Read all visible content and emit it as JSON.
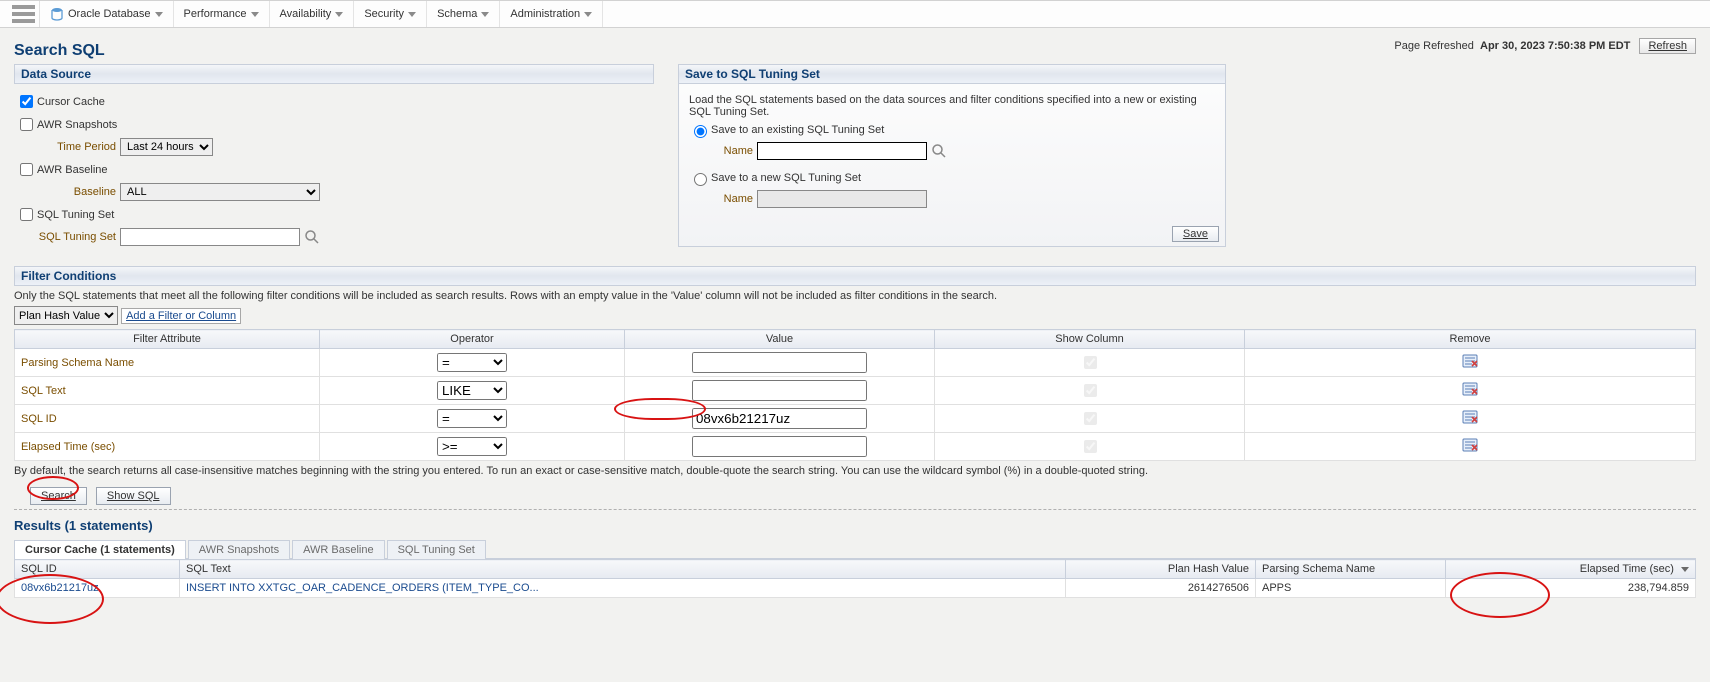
{
  "menu": {
    "items": [
      "Oracle Database",
      "Performance",
      "Availability",
      "Security",
      "Schema",
      "Administration"
    ]
  },
  "page_title": "Search SQL",
  "refresh": {
    "label": "Page Refreshed",
    "stamp": "Apr 30, 2023 7:50:38 PM EDT",
    "button": "Refresh"
  },
  "datasource": {
    "header": "Data Source",
    "cursor_cache": {
      "label": "Cursor Cache",
      "checked": true
    },
    "awr_snapshots": {
      "label": "AWR Snapshots",
      "checked": false,
      "time_label": "Time Period",
      "time_value": "Last 24 hours"
    },
    "awr_baseline": {
      "label": "AWR Baseline",
      "checked": false,
      "baseline_label": "Baseline",
      "baseline_value": "ALL"
    },
    "sts": {
      "label": "SQL Tuning Set",
      "checked": false,
      "field_label": "SQL Tuning Set",
      "value": ""
    }
  },
  "save_sts": {
    "header": "Save to SQL Tuning Set",
    "intro": "Load the SQL statements based on the data sources and filter conditions specified into a new or existing SQL Tuning Set.",
    "opt_existing": "Save to an existing SQL Tuning Set",
    "opt_new": "Save to a new SQL Tuning Set",
    "name_label": "Name",
    "existing_value": "",
    "new_value": "",
    "save_btn": "Save"
  },
  "filters": {
    "header": "Filter Conditions",
    "intro": "Only the SQL statements that meet all the following filter conditions will be included as search results. Rows with an empty value in the 'Value' column will not be included as filter conditions in the search.",
    "add_selector": "Plan Hash Value",
    "add_link": "Add a Filter or Column",
    "columns": {
      "attr": "Filter Attribute",
      "op": "Operator",
      "val": "Value",
      "show": "Show Column",
      "remove": "Remove"
    },
    "rows": [
      {
        "attr": "Parsing Schema Name",
        "op": "=",
        "val": "",
        "show": true
      },
      {
        "attr": "SQL Text",
        "op": "LIKE",
        "val": "",
        "show": true
      },
      {
        "attr": "SQL ID",
        "op": "=",
        "val": "08vx6b21217uz",
        "show": true
      },
      {
        "attr": "Elapsed Time (sec)",
        "op": ">=",
        "val": "",
        "show": true
      }
    ],
    "note": "By default, the search returns all case-insensitive matches beginning with the string you entered. To run an exact or case-sensitive match, double-quote the search string. You can use the wildcard symbol (%) in a double-quoted string.",
    "search_btn": "Search",
    "showsql_btn": "Show SQL"
  },
  "results": {
    "header": "Results (1 statements)",
    "tabs": [
      "Cursor Cache (1 statements)",
      "AWR Snapshots",
      "AWR Baseline",
      "SQL Tuning Set"
    ],
    "columns": {
      "sqlid": "SQL ID",
      "sqltext": "SQL Text",
      "phv": "Plan Hash Value",
      "schema": "Parsing Schema Name",
      "elapsed": "Elapsed Time (sec)"
    },
    "rows": [
      {
        "sqlid": "08vx6b21217uz",
        "sqltext": "INSERT INTO XXTGC_OAR_CADENCE_ORDERS (ITEM_TYPE_CO...",
        "phv": "2614276506",
        "schema": "APPS",
        "elapsed": "238,794.859"
      }
    ]
  }
}
